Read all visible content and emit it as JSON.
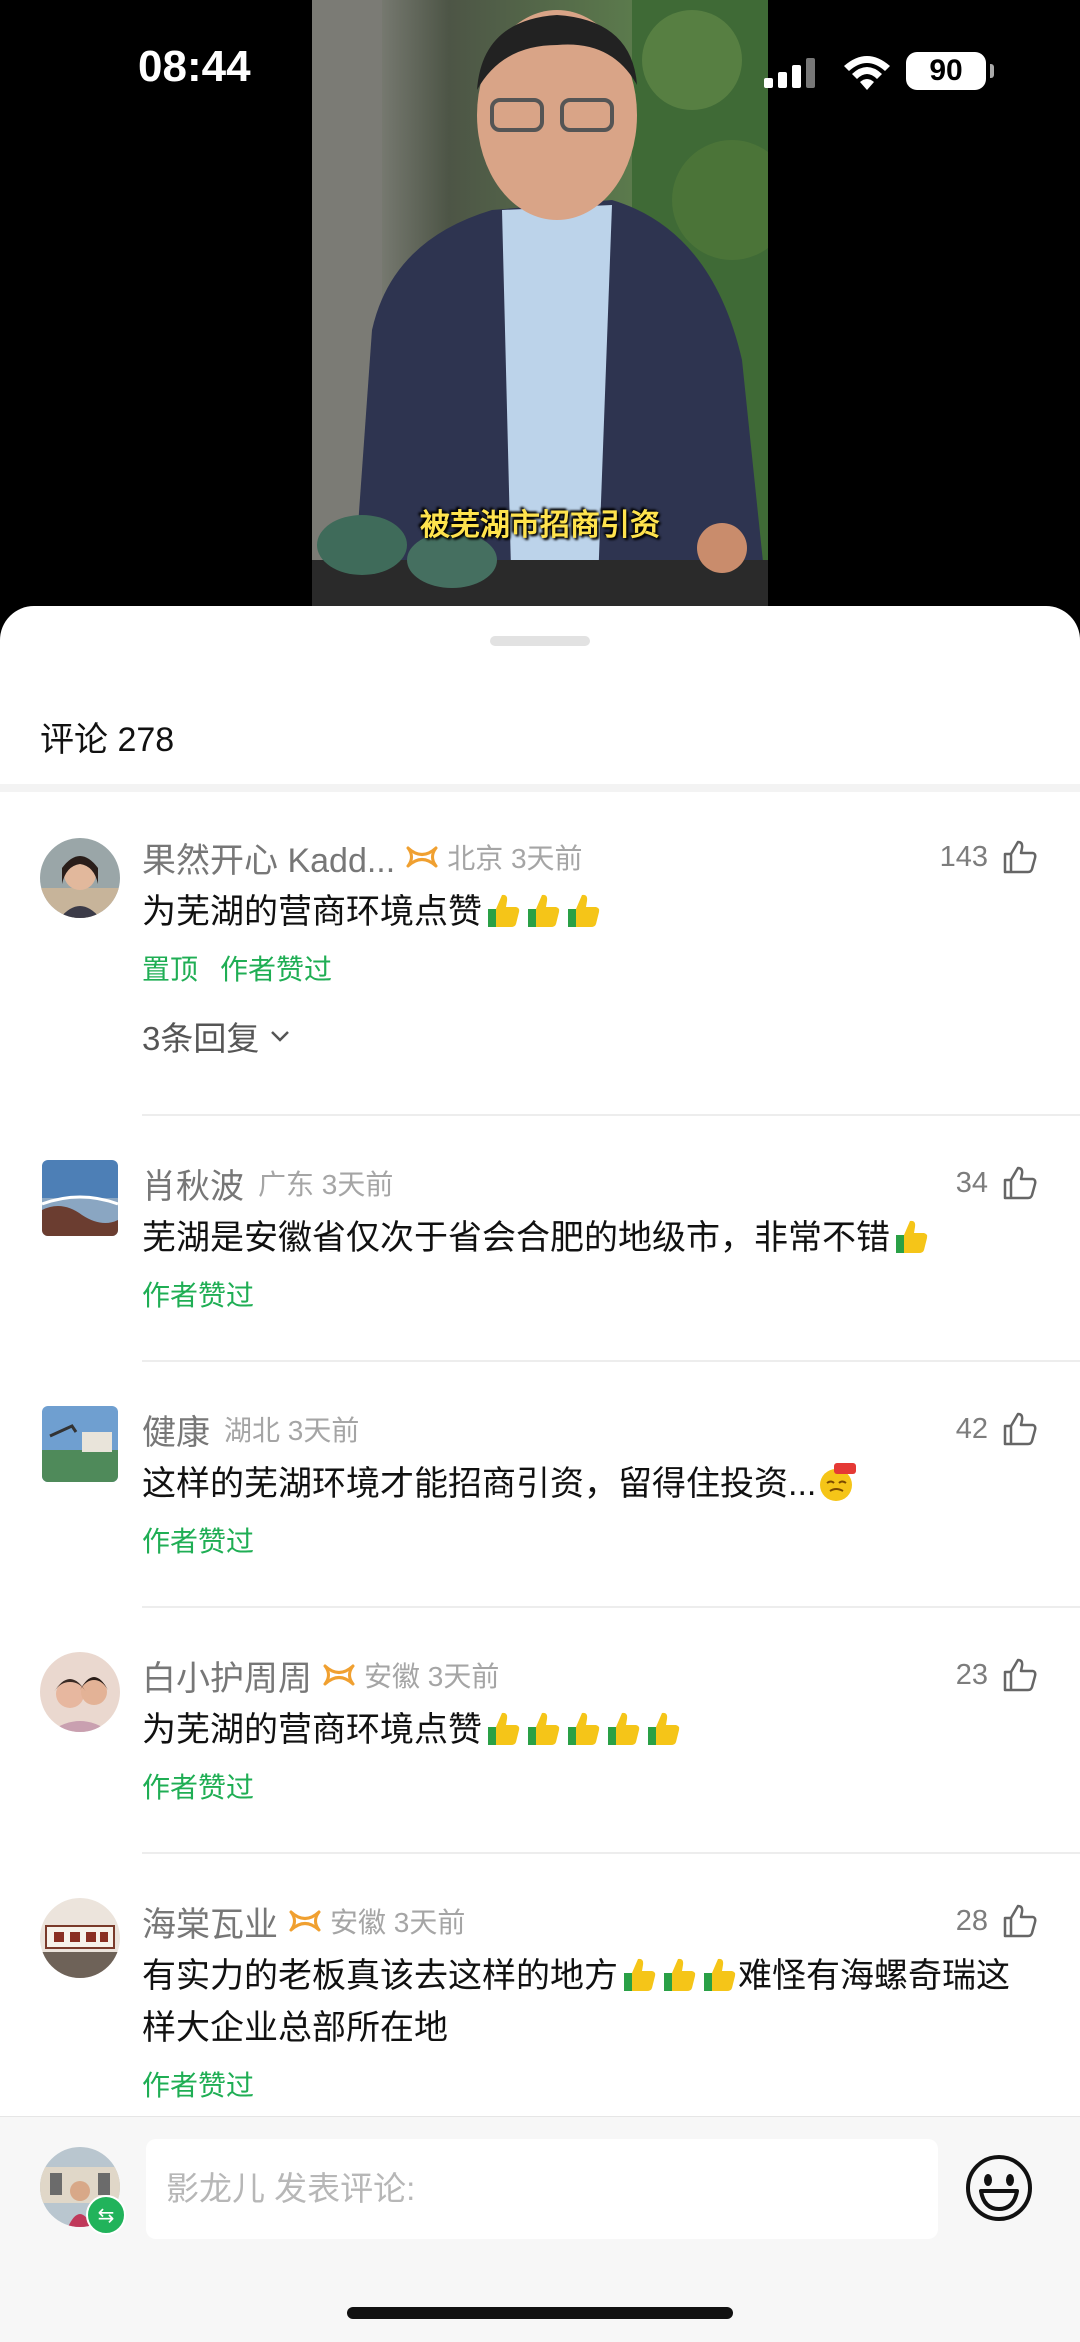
{
  "status_bar": {
    "time": "08:44",
    "battery": "90"
  },
  "video": {
    "subtitle": "被芜湖市招商引资"
  },
  "sheet": {
    "title": "评论 278"
  },
  "comments": [
    {
      "user": "果然开心 Kadd...",
      "vip": true,
      "region_time": "北京 3天前",
      "likes": "143",
      "text": "为芜湖的营商环境点赞",
      "emoji_count": 3,
      "tags": [
        "置顶",
        "作者赞过"
      ],
      "replies": "3条回复"
    },
    {
      "user": "肖秋波",
      "vip": false,
      "region_time": "广东 3天前",
      "likes": "34",
      "text": "芜湖是安徽省仅次于省会合肥的地级市，非常不错",
      "emoji_count": 1,
      "tags": [
        "作者赞过"
      ]
    },
    {
      "user": "健康",
      "vip": false,
      "region_time": "湖北 3天前",
      "likes": "42",
      "text": "这样的芜湖环境才能招商引资，留得住投资...",
      "tags": [
        "作者赞过"
      ]
    },
    {
      "user": "白小护周周",
      "vip": true,
      "region_time": "安徽 3天前",
      "likes": "23",
      "text": "为芜湖的营商环境点赞",
      "emoji_count": 5,
      "tags": [
        "作者赞过"
      ]
    },
    {
      "user": "海棠瓦业",
      "vip": true,
      "region_time": "安徽 3天前",
      "likes": "28",
      "text_part1": "有实力的老板真该去这样的地方",
      "text_part2": "难怪有海螺奇瑞这样大企业总部所在地",
      "emoji_count": 3,
      "tags": [
        "作者赞过"
      ]
    }
  ],
  "input_bar": {
    "placeholder": "影龙儿  发表评论:"
  },
  "colors": {
    "accent_green": "#1fae54",
    "vip_orange": "#f0a030",
    "emoji_yellow": "#f5c518"
  }
}
